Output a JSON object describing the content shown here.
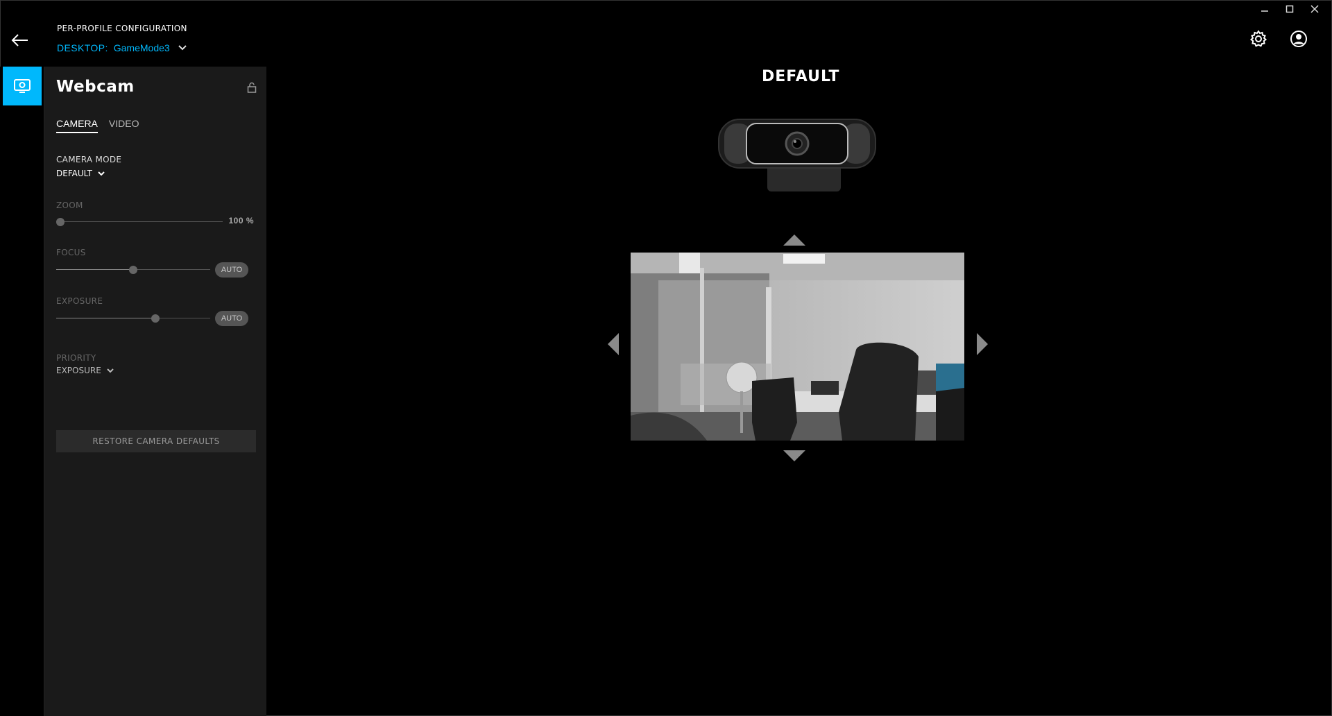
{
  "window": {
    "controls": [
      "minimize",
      "maximize",
      "close"
    ]
  },
  "header": {
    "title": "PER-PROFILE CONFIGURATION",
    "profile_prefix": "DESKTOP:",
    "profile_name": "GameMode3"
  },
  "rail": {
    "items": [
      {
        "icon": "webcam-icon",
        "active": true
      }
    ]
  },
  "panel": {
    "title": "Webcam",
    "tabs": [
      {
        "label": "CAMERA",
        "active": true
      },
      {
        "label": "VIDEO",
        "active": false
      }
    ],
    "camera_mode": {
      "label": "CAMERA MODE",
      "value": "DEFAULT"
    },
    "zoom": {
      "label": "ZOOM",
      "value": "100 %",
      "level": 0.0
    },
    "focus": {
      "label": "FOCUS",
      "auto_label": "AUTO",
      "level": 0.5
    },
    "exposure": {
      "label": "EXPOSURE",
      "auto_label": "AUTO",
      "level": 0.65
    },
    "priority": {
      "label": "PRIORITY",
      "value": "EXPOSURE"
    },
    "restore_label": "RESTORE CAMERA DEFAULTS"
  },
  "main": {
    "mode_title": "DEFAULT"
  },
  "colors": {
    "accent": "#00b8fc",
    "panel_bg": "#1a1a1a",
    "bg": "#000000"
  }
}
